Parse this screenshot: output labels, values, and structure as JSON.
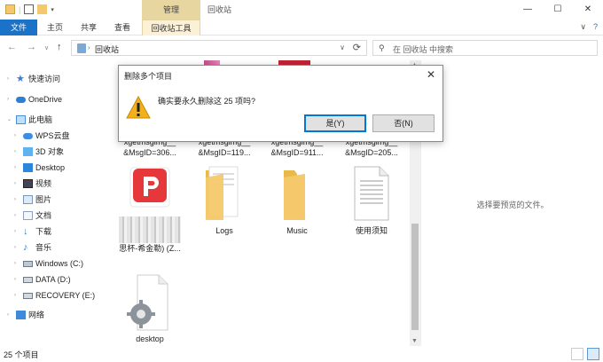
{
  "window": {
    "title": "回收站",
    "context_tab": "管理",
    "controls": {
      "minimize": "—",
      "maximize": "☐",
      "close": "✕"
    }
  },
  "ribbon": {
    "tabs": [
      "文件",
      "主页",
      "共享",
      "查看",
      "回收站工具"
    ],
    "expand": "∨",
    "help": "?"
  },
  "address": {
    "path": "回收站",
    "search_placeholder": "在 回收站 中搜索"
  },
  "sidebar": {
    "items": [
      {
        "label": "快速访问",
        "icon": "star-icon"
      },
      {
        "label": "OneDrive",
        "icon": "cloud-icon"
      },
      {
        "label": "此电脑",
        "icon": "computer-icon"
      },
      {
        "label": "WPS云盘",
        "icon": "wps-cloud-icon"
      },
      {
        "label": "3D 对象",
        "icon": "cube-icon"
      },
      {
        "label": "Desktop",
        "icon": "desktop-icon"
      },
      {
        "label": "视频",
        "icon": "video-icon"
      },
      {
        "label": "图片",
        "icon": "picture-icon"
      },
      {
        "label": "文档",
        "icon": "document-icon"
      },
      {
        "label": "下载",
        "icon": "download-icon"
      },
      {
        "label": "音乐",
        "icon": "music-icon"
      },
      {
        "label": "Windows (C:)",
        "icon": "drive-icon"
      },
      {
        "label": "DATA (D:)",
        "icon": "drive-icon"
      },
      {
        "label": "RECOVERY (E:)",
        "icon": "drive-icon"
      },
      {
        "label": "网络",
        "icon": "network-icon"
      }
    ]
  },
  "files": {
    "row1": [
      {
        "line1": "xgetmsgimg__",
        "line2": "&MsgID=306..."
      },
      {
        "line1": "xgetmsgimg__",
        "line2": "&MsgID=119..."
      },
      {
        "line1": "xgetmsgimg__",
        "line2": "&MsgID=911..."
      },
      {
        "line1": "xgetmsgimg__",
        "line2": "&MsgID=205..."
      }
    ],
    "row2": [
      {
        "name": "思杯-希金勒) (Z..."
      },
      {
        "name": "Logs"
      },
      {
        "name": "Music"
      },
      {
        "name": "使用须知"
      }
    ],
    "row3": [
      {
        "name": "desktop"
      }
    ]
  },
  "preview": {
    "message": "选择要预览的文件。"
  },
  "status": {
    "count": "25 个项目"
  },
  "dialog": {
    "title": "删除多个项目",
    "message": "确实要永久删除这 25 项吗?",
    "yes": "是(Y)",
    "no": "否(N)",
    "close": "✕"
  },
  "colors": {
    "accent": "#1a73c8",
    "context_tab": "#e8d6a0",
    "warning": "#f2b01e",
    "folder": "#f5c96b"
  }
}
